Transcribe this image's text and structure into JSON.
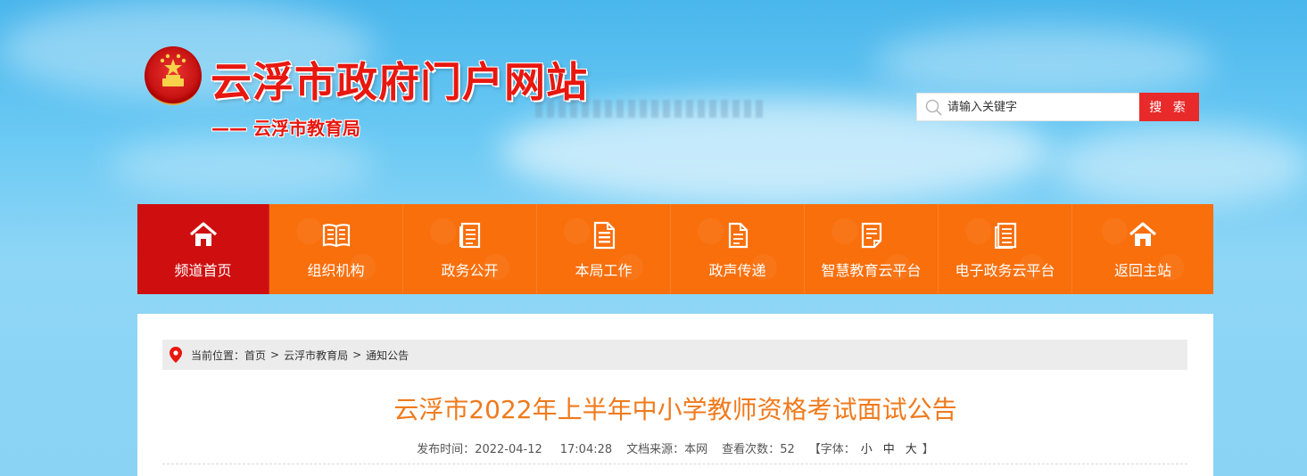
{
  "header": {
    "site_title": "云浮市政府门户网站",
    "sub_title": "—— 云浮市教育局"
  },
  "search": {
    "placeholder": "请输入关键字",
    "button_label": "搜 索"
  },
  "nav": {
    "items": [
      {
        "label": "频道首页",
        "icon": "home-icon",
        "active": true
      },
      {
        "label": "组织机构",
        "icon": "book-icon"
      },
      {
        "label": "政务公开",
        "icon": "document-icon"
      },
      {
        "label": "本局工作",
        "icon": "file-list-icon"
      },
      {
        "label": "政声传递",
        "icon": "notes-icon"
      },
      {
        "label": "智慧教育云平台",
        "icon": "edit-document-icon"
      },
      {
        "label": "电子政务云平台",
        "icon": "pages-icon"
      },
      {
        "label": "返回主站",
        "icon": "home-icon"
      }
    ]
  },
  "breadcrumb": {
    "prefix": "当前位置：",
    "items": [
      "首页",
      "云浮市教育局",
      "通知公告"
    ],
    "separator": ">"
  },
  "article": {
    "title": "云浮市2022年上半年中小学教师资格考试面试公告",
    "publish_label": "发布时间：",
    "publish_date": "2022-04-12",
    "publish_time": "17:04:28",
    "source_label": "文档来源：",
    "source": "本网",
    "views_label": "查看次数：",
    "views": "52",
    "font_label": "【字体：",
    "font_small": "小",
    "font_medium": "中",
    "font_large": "大",
    "font_close": "】"
  },
  "colors": {
    "nav_orange": "#f96f0c",
    "nav_active_red": "#cf0f0f",
    "title_red": "#e8170f",
    "article_title_orange": "#f07a1c",
    "search_button_red": "#e92a2a"
  }
}
